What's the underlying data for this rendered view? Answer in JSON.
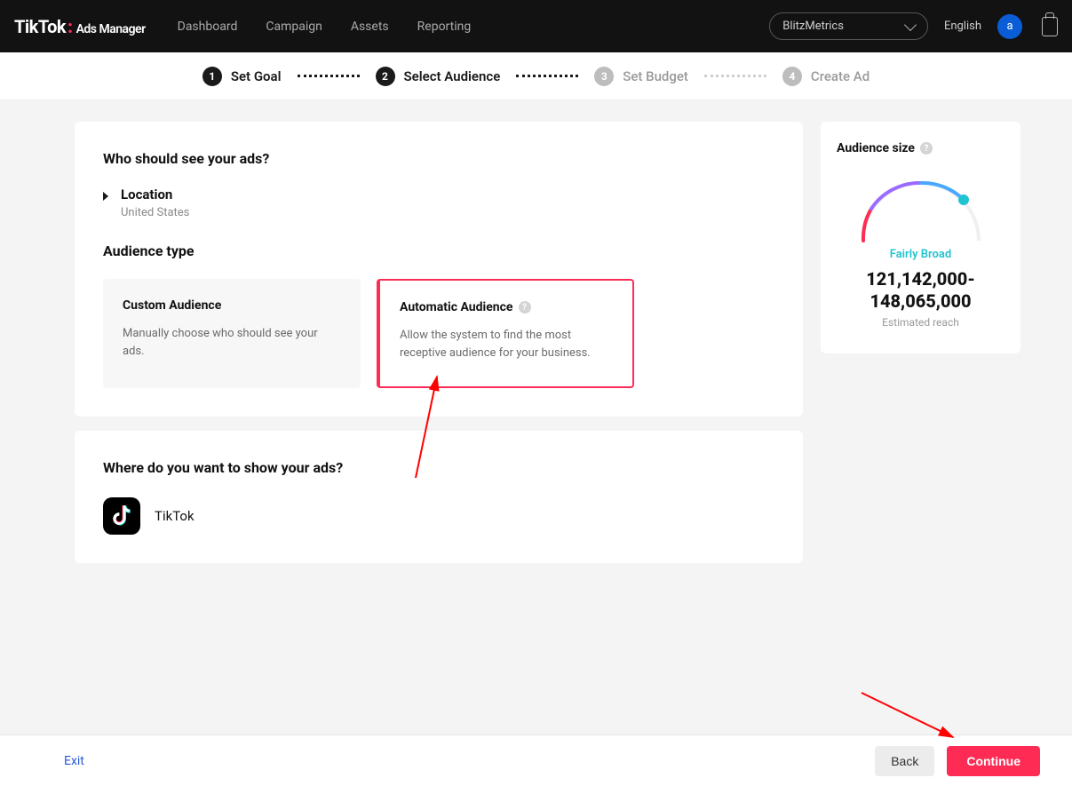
{
  "header": {
    "logo_main": "TikTok",
    "logo_sub": "Ads Manager",
    "nav": [
      "Dashboard",
      "Campaign",
      "Assets",
      "Reporting"
    ],
    "account": "BlitzMetrics",
    "language": "English",
    "avatar_initial": "a"
  },
  "stepper": [
    {
      "num": "1",
      "label": "Set Goal",
      "active": true
    },
    {
      "num": "2",
      "label": "Select Audience",
      "active": true
    },
    {
      "num": "3",
      "label": "Set Budget",
      "active": false
    },
    {
      "num": "4",
      "label": "Create Ad",
      "active": false
    }
  ],
  "audience_card": {
    "title": "Who should see your ads?",
    "location_label": "Location",
    "location_value": "United States",
    "type_label": "Audience type",
    "options": [
      {
        "title": "Custom Audience",
        "desc": "Manually choose who should see your ads."
      },
      {
        "title": "Automatic Audience",
        "desc": "Allow the system to find the most receptive audience for your business."
      }
    ]
  },
  "placements_card": {
    "title": "Where do you want to show your ads?",
    "placement": "TikTok"
  },
  "size_card": {
    "title": "Audience size",
    "level": "Fairly Broad",
    "range": "121,142,000-148,065,000",
    "estimated": "Estimated reach"
  },
  "footer": {
    "exit": "Exit",
    "back": "Back",
    "continue": "Continue"
  }
}
